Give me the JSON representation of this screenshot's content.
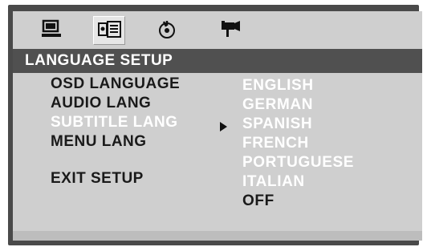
{
  "window": {
    "title": "LANGUAGE SETUP"
  },
  "icons": [
    {
      "name": "general-setup-icon",
      "selected": false
    },
    {
      "name": "language-setup-icon",
      "selected": true
    },
    {
      "name": "audio-setup-icon",
      "selected": false
    },
    {
      "name": "video-setup-icon",
      "selected": false
    }
  ],
  "menu": {
    "items": [
      {
        "label": "OSD LANGUAGE"
      },
      {
        "label": "AUDIO LANG"
      },
      {
        "label": "SUBTITLE LANG",
        "active": true
      },
      {
        "label": "MENU LANG"
      },
      {
        "label": "EXIT SETUP"
      }
    ]
  },
  "submenu": {
    "options": [
      {
        "label": "ENGLISH"
      },
      {
        "label": "GERMAN"
      },
      {
        "label": "SPANISH"
      },
      {
        "label": "FRENCH"
      },
      {
        "label": "PORTUGUESE"
      },
      {
        "label": "ITALIAN"
      },
      {
        "label": "OFF",
        "dark": true
      }
    ]
  },
  "colors": {
    "screen_bg": "#cfcfcf",
    "title_bar": "#505050",
    "highlight_text": "#ffffff",
    "normal_text": "#1a1a1a"
  }
}
